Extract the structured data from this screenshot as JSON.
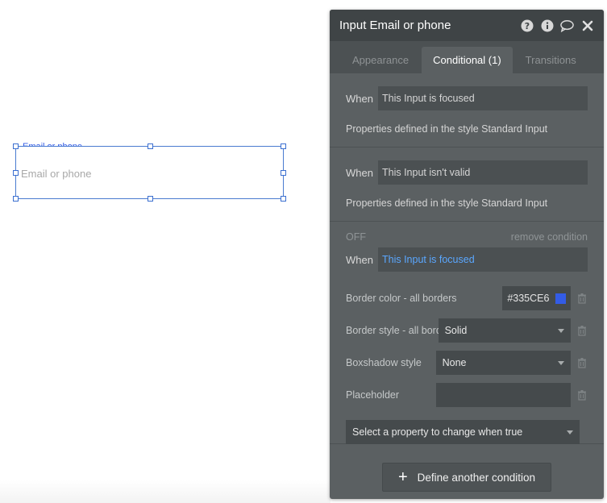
{
  "canvas": {
    "element_label": "Email or phone",
    "placeholder": "Email or phone"
  },
  "panel": {
    "title": "Input Email or phone",
    "tabs": [
      {
        "label": "Appearance",
        "active": false
      },
      {
        "label": "Conditional (1)",
        "active": true
      },
      {
        "label": "Transitions",
        "active": false
      }
    ],
    "conditions": [
      {
        "when_label": "When",
        "expression": "This Input is focused",
        "properties": "Properties defined in the style Standard Input"
      },
      {
        "when_label": "When",
        "expression": "This Input isn't valid",
        "properties": "Properties defined in the style Standard Input"
      }
    ],
    "custom_condition": {
      "status": "OFF",
      "remove_label": "remove condition",
      "when_label": "When",
      "expression": "This Input is focused",
      "properties": {
        "border_color_label": "Border color - all borders",
        "border_color_value": "#335CE6",
        "border_style_label": "Border style - all borders",
        "border_style_value": "Solid",
        "boxshadow_label": "Boxshadow style",
        "boxshadow_value": "None",
        "placeholder_label": "Placeholder",
        "placeholder_value": ""
      },
      "select_property": "Select a property to change when true"
    },
    "define_button": "Define another condition"
  },
  "colors": {
    "accent": "#335CE6",
    "panel_bg": "#5B6062",
    "header_bg": "#3F4446"
  },
  "icons": [
    "help-icon",
    "info-icon",
    "comment-icon",
    "close-icon",
    "trash-icon",
    "plus-icon",
    "caret-down-icon"
  ]
}
